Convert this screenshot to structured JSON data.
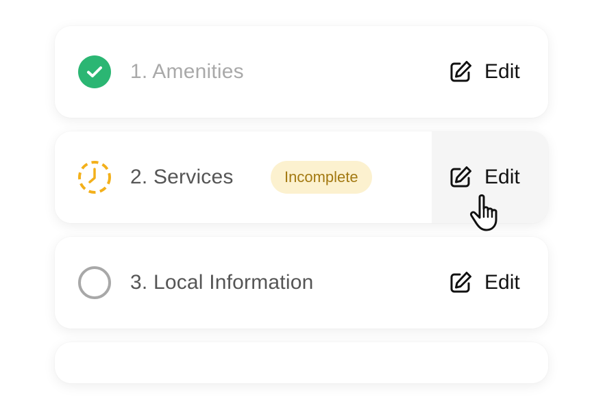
{
  "steps": [
    {
      "label": "1. Amenities",
      "status": "complete",
      "edit_label": "Edit"
    },
    {
      "label": "2. Services",
      "status": "incomplete",
      "badge": "Incomplete",
      "edit_label": "Edit"
    },
    {
      "label": "3. Local Information",
      "status": "not-started",
      "edit_label": "Edit"
    }
  ],
  "colors": {
    "complete": "#2bb673",
    "incomplete": "#f3b01b",
    "not_started": "#a8a8a8",
    "badge_bg": "#fcf1cf",
    "badge_text": "#a37911"
  },
  "icons": {
    "complete": "check-circle-icon",
    "incomplete": "dashed-clock-icon",
    "not_started": "empty-circle-icon",
    "edit": "pencil-square-icon",
    "cursor": "hand-pointer-cursor"
  }
}
